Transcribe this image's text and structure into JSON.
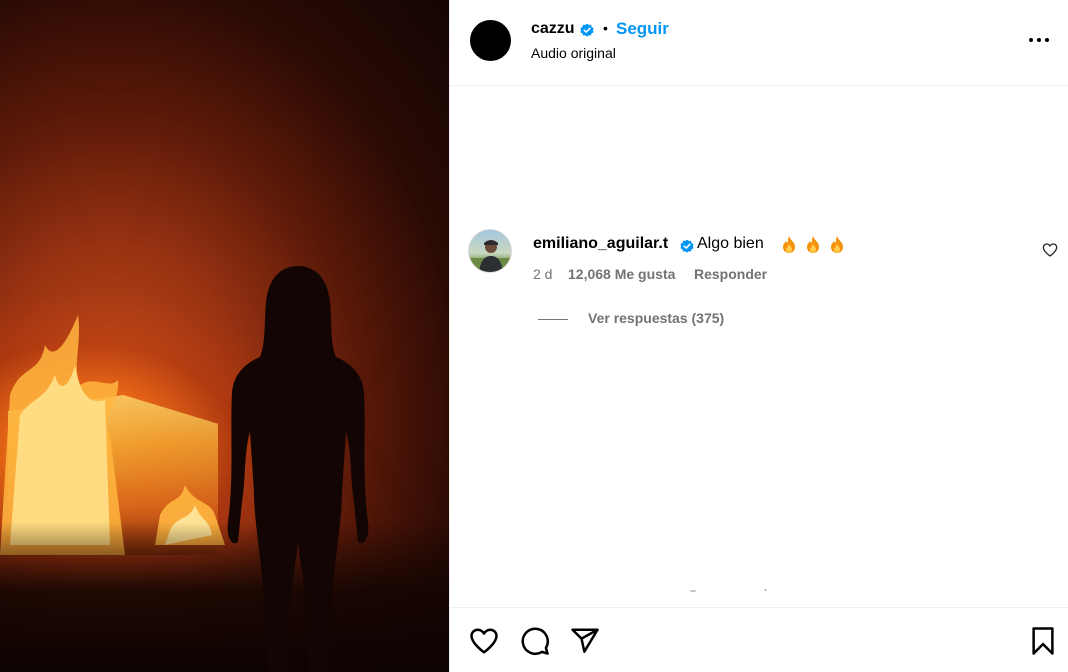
{
  "post": {
    "username": "cazzu",
    "follow_label": "Seguir",
    "separator": "•",
    "subtitle": "Audio original"
  },
  "comment": {
    "username": "emiliano_aguilar.t",
    "text": "Algo bien",
    "emojis": [
      "fire-emoji",
      "fire-emoji",
      "fire-emoji"
    ],
    "time": "2 d",
    "likes": "12,068 Me gusta",
    "reply_label": "Responder",
    "view_replies": "Ver respuestas (375)"
  },
  "icons": {
    "verified": "verified-badge-icon",
    "more": "more-options-icon",
    "like": "heart-icon",
    "comment": "comment-icon",
    "share": "share-icon",
    "save": "bookmark-icon"
  },
  "colors": {
    "accent": "#0095f6",
    "secondary_text": "#737373",
    "verified": "#0095f6"
  }
}
